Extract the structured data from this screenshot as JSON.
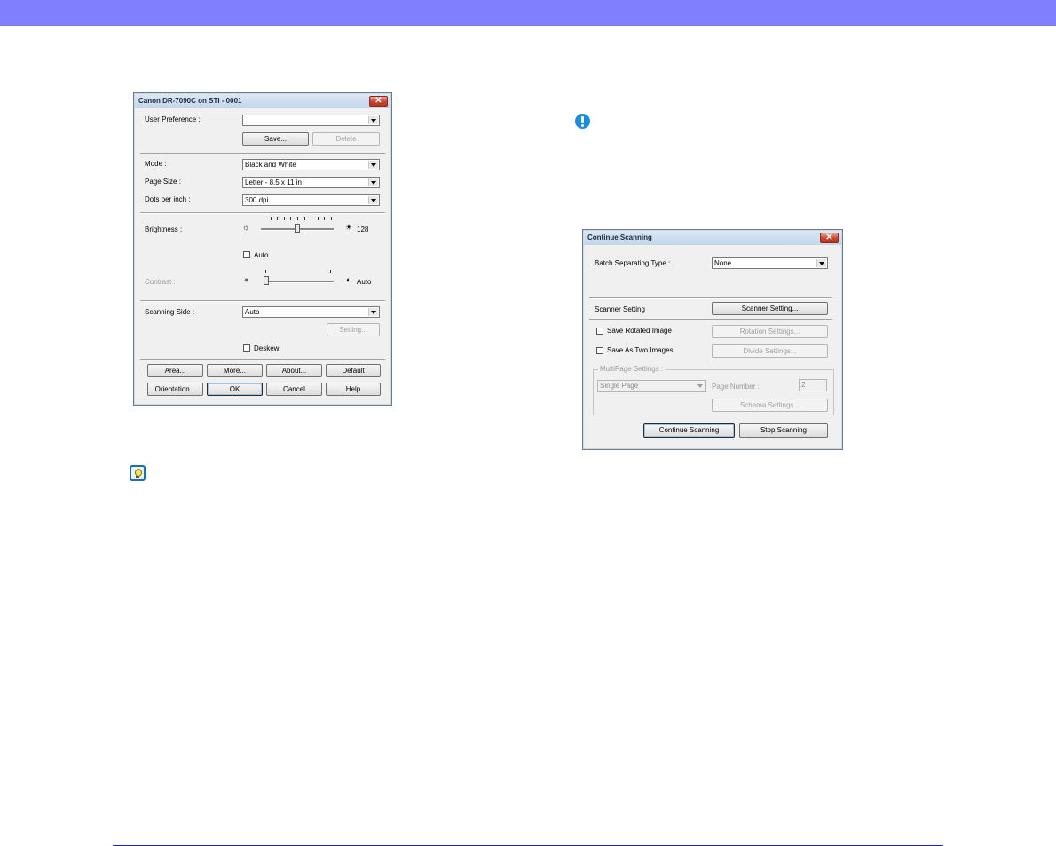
{
  "dialog1": {
    "title": "Canon DR-7090C on STI - 0001",
    "close_glyph": "✕",
    "user_preference": {
      "label": "User Preference :",
      "value": ""
    },
    "save_button": "Save...",
    "delete_button": "Delete",
    "mode": {
      "label": "Mode :",
      "value": "Black and White"
    },
    "page_size": {
      "label": "Page Size :",
      "value": "Letter - 8.5 x 11 in"
    },
    "dpi": {
      "label": "Dots per inch :",
      "value": "300 dpi"
    },
    "brightness": {
      "label": "Brightness :",
      "value": "128",
      "level": 0.5
    },
    "auto_label": "Auto",
    "contrast": {
      "label": "Contrast :",
      "value_text": "Auto",
      "level": 0.0
    },
    "scanning_side": {
      "label": "Scanning Side :",
      "value": "Auto"
    },
    "setting_button": "Setting...",
    "deskew_label": "Deskew",
    "buttons_row1": [
      "Area...",
      "More...",
      "About...",
      "Default"
    ],
    "buttons_row2": [
      "Orientation...",
      "OK",
      "Cancel",
      "Help"
    ]
  },
  "dialog2": {
    "title": "Continue Scanning",
    "close_glyph": "✕",
    "batch_label": "Batch Separating Type :",
    "batch_value": "None",
    "scanner_setting_label": "Scanner Setting",
    "scanner_setting_button": "Scanner Setting...",
    "save_rotated_label": "Save Rotated Image",
    "rotation_settings_button": "Rotation Settings...",
    "save_two_label": "Save As Two Images",
    "divide_settings_button": "Divide Settings...",
    "multipage_group_label": "MultiPage Settings :",
    "multipage_value": "Single Page",
    "page_number_label": "Page Number :",
    "page_number_value": "2",
    "schema_settings_button": "Schema Settings...",
    "continue_button": "Continue Scanning",
    "stop_button": "Stop Scanning"
  },
  "icons": {
    "warning": "exclamation-icon",
    "hint": "lightbulb-icon"
  },
  "colors": {
    "top_bar": "#8080ff",
    "bottom_rule": "#2020c0",
    "warning_icon": "#1a8ce0"
  }
}
